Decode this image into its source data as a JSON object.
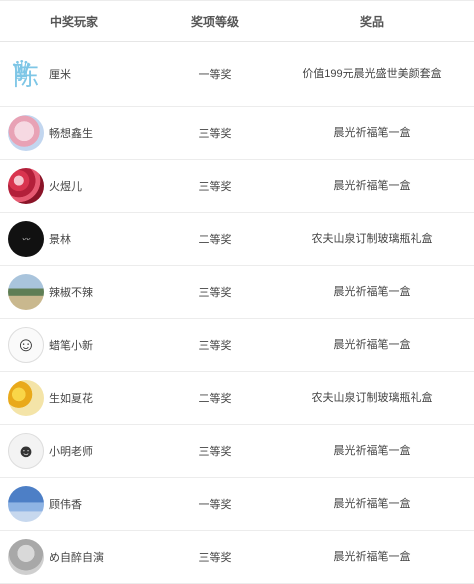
{
  "headers": {
    "player": "中奖玩家",
    "level": "奖项等级",
    "prize": "奖品"
  },
  "rows": [
    {
      "name": "厘米",
      "level": "一等奖",
      "prize": "价值199元晨光盛世美颜套盒",
      "avatar": "chen-character-avatar",
      "avatar_text": "陈"
    },
    {
      "name": "畅想鑫生",
      "level": "三等奖",
      "prize": "晨光祈福笔一盒",
      "avatar": "pink-cartoon-avatar"
    },
    {
      "name": "火煜儿",
      "level": "三等奖",
      "prize": "晨光祈福笔一盒",
      "avatar": "red-flower-avatar"
    },
    {
      "name": "景林",
      "level": "二等奖",
      "prize": "农夫山泉订制玻璃瓶礼盒",
      "avatar": "black-calligraphy-avatar"
    },
    {
      "name": "辣椒不辣",
      "level": "三等奖",
      "prize": "晨光祈福笔一盒",
      "avatar": "landscape-avatar"
    },
    {
      "name": "蜡笔小新",
      "level": "三等奖",
      "prize": "晨光祈福笔一盒",
      "avatar": "sketch-avatar"
    },
    {
      "name": "生如夏花",
      "level": "二等奖",
      "prize": "农夫山泉订制玻璃瓶礼盒",
      "avatar": "yellow-flower-avatar"
    },
    {
      "name": "小明老师",
      "level": "三等奖",
      "prize": "晨光祈福笔一盒",
      "avatar": "cartoon-girl-avatar"
    },
    {
      "name": "顾伟香",
      "level": "一等奖",
      "prize": "晨光祈福笔一盒",
      "avatar": "city-avatar"
    },
    {
      "name": "め自醉自演",
      "level": "三等奖",
      "prize": "晨光祈福笔一盒",
      "avatar": "grey-avatar"
    }
  ]
}
